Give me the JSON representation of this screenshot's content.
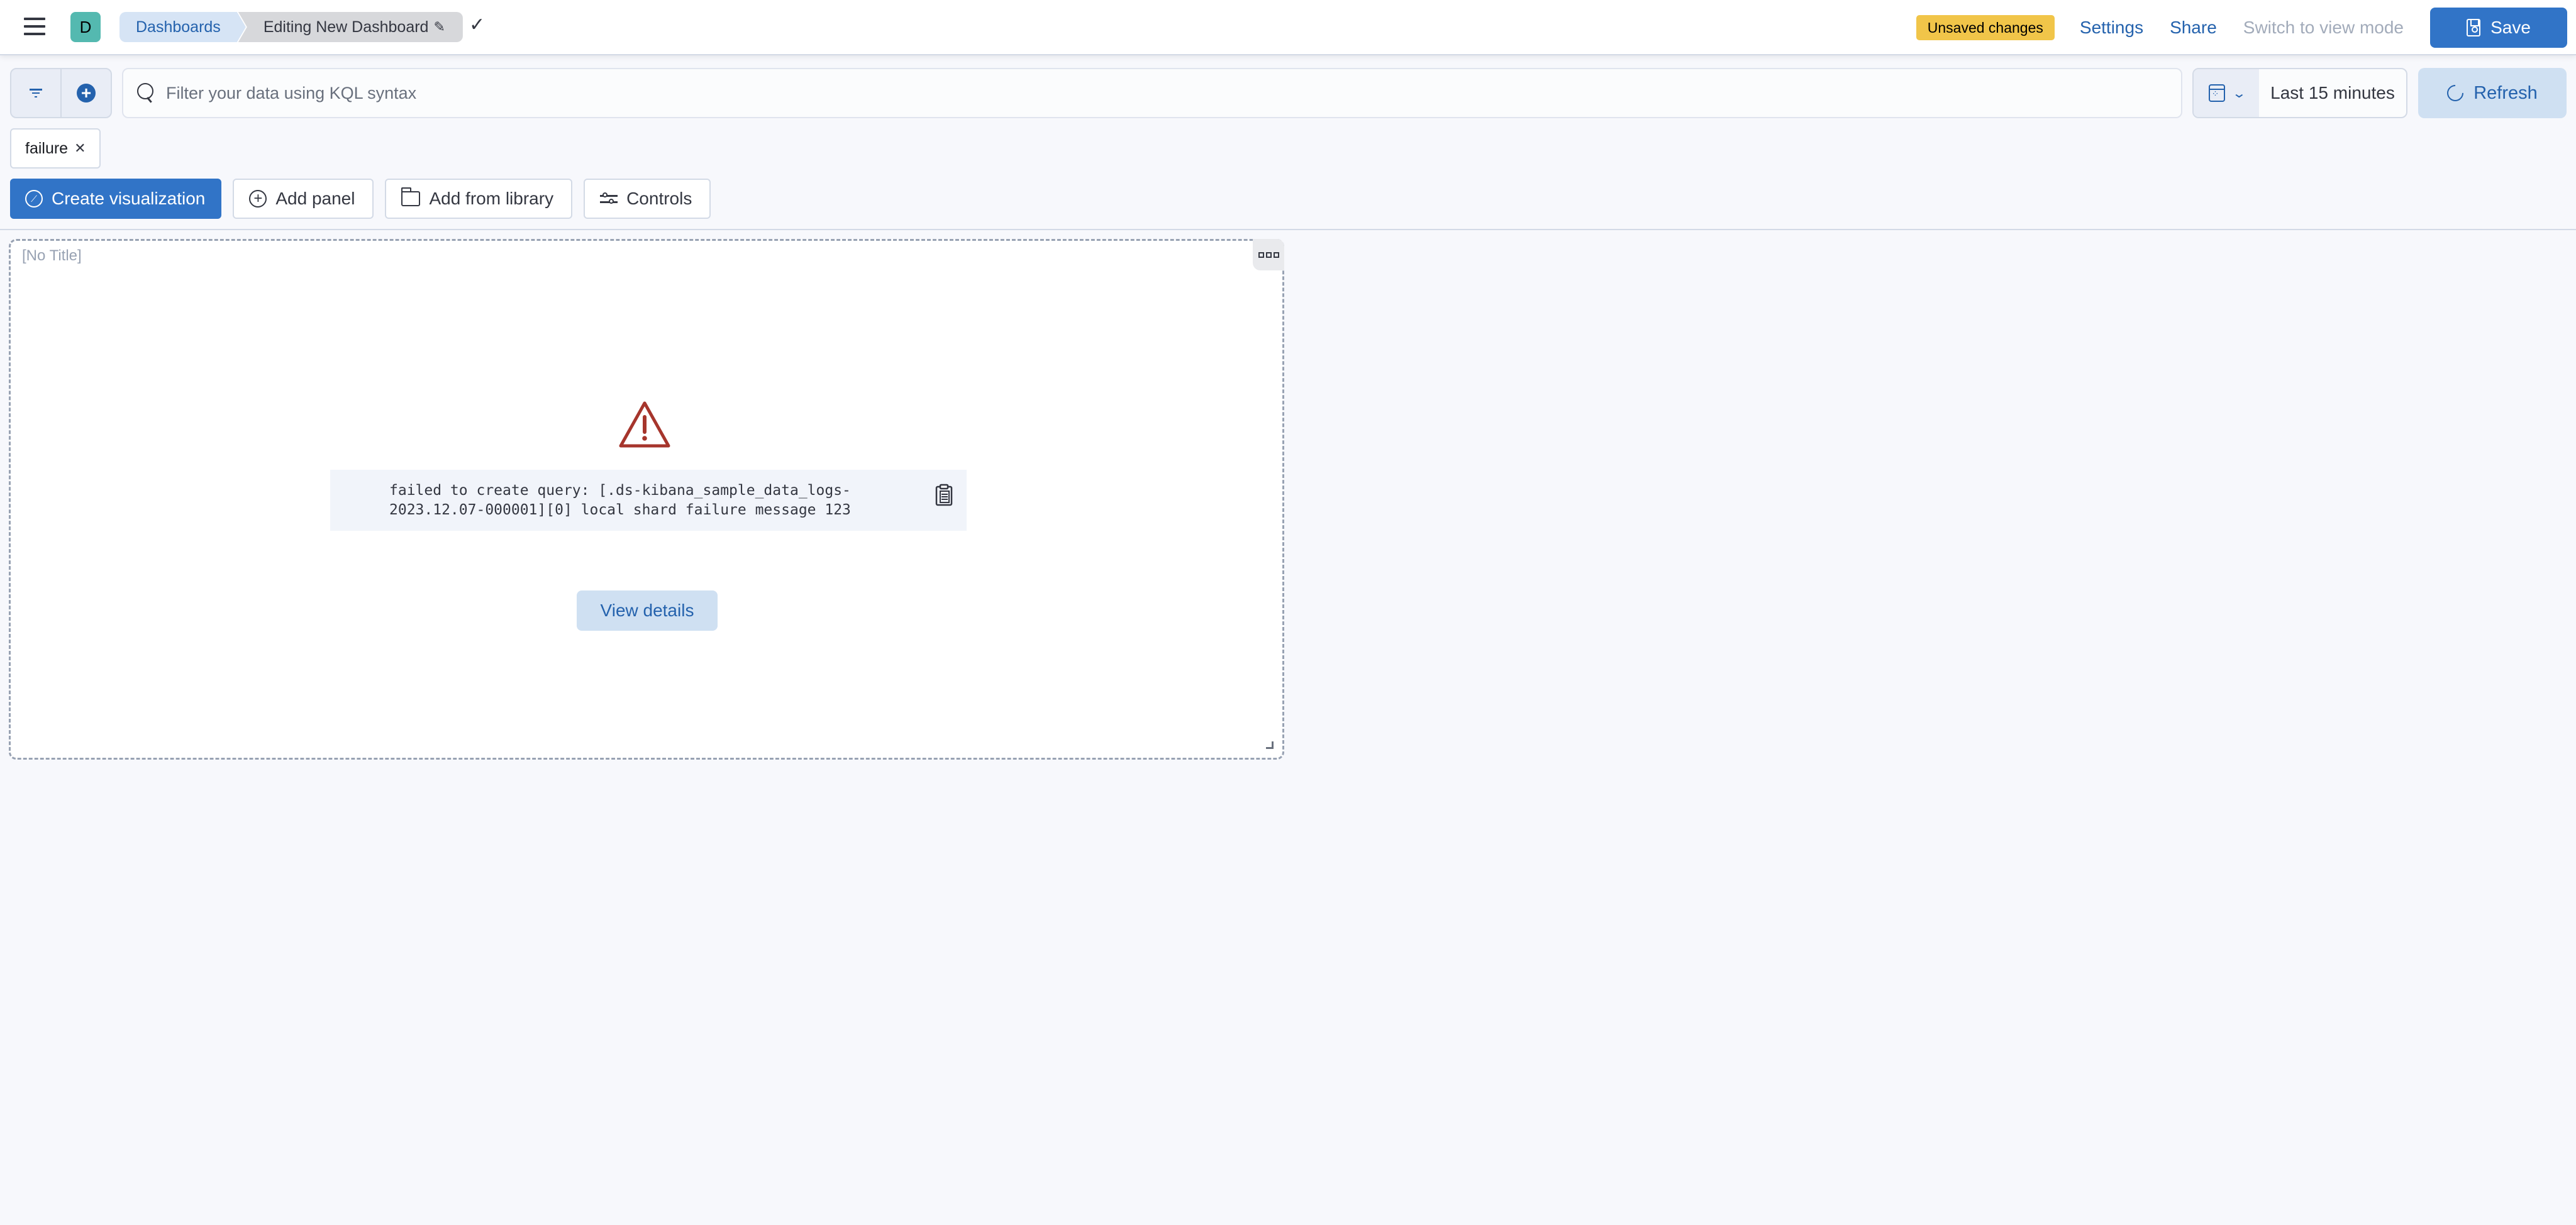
{
  "header": {
    "space_initial": "D",
    "breadcrumbs": [
      {
        "label": "Dashboards"
      },
      {
        "label": "Editing New Dashboard"
      }
    ],
    "unsaved_badge": "Unsaved changes",
    "settings_label": "Settings",
    "share_label": "Share",
    "switch_mode_label": "Switch to view mode",
    "save_label": "Save"
  },
  "query_bar": {
    "search_placeholder": "Filter your data using KQL syntax",
    "search_value": "",
    "time_range": "Last 15 minutes",
    "refresh_label": "Refresh"
  },
  "filters": [
    {
      "label": "failure"
    }
  ],
  "toolbar": {
    "create_visualization": "Create visualization",
    "add_panel": "Add panel",
    "add_from_library": "Add from library",
    "controls": "Controls"
  },
  "panel": {
    "title": "[No Title]",
    "error_message": "failed to create query: [.ds-kibana_sample_data_logs-\n2023.12.07-000001][0] local shard failure message 123",
    "view_details_label": "View details"
  },
  "colors": {
    "primary": "#3174c7",
    "link": "#2462ad",
    "warning_badge": "#f1c549",
    "danger": "#bd271e",
    "space_avatar": "#54b9b0"
  }
}
